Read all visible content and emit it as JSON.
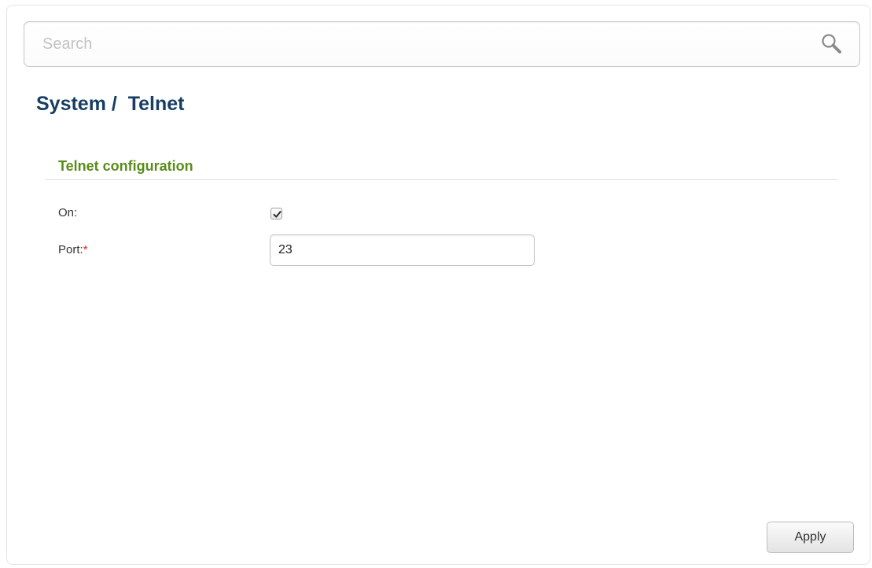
{
  "search": {
    "placeholder": "Search",
    "icon": "search-icon"
  },
  "breadcrumb": {
    "text": "System /  Telnet"
  },
  "section": {
    "title": "Telnet configuration"
  },
  "fields": {
    "on": {
      "label": "On:",
      "checked": true
    },
    "port": {
      "label": "Port:",
      "required_marker": "*",
      "value": "23"
    }
  },
  "actions": {
    "apply_label": "Apply"
  },
  "colors": {
    "breadcrumb": "#173e63",
    "section_title": "#5a8c1a",
    "required": "#e01f1f"
  }
}
